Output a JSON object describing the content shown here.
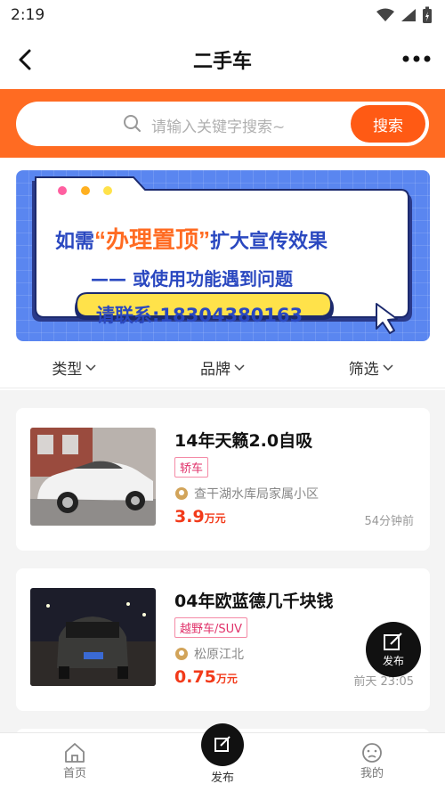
{
  "status": {
    "time": "2:19"
  },
  "header": {
    "title": "二手车"
  },
  "search": {
    "placeholder": "请输入关键字搜索~",
    "button": "搜索"
  },
  "banner": {
    "line1_pre": "如需",
    "line1_quote": "“办理置顶”",
    "line1_post": "扩大宣传效果",
    "line2": "—— 或使用功能遇到问题",
    "contact": "请联系:18304380163"
  },
  "filters": [
    "类型",
    "品牌",
    "筛选"
  ],
  "listings": [
    {
      "title": "14年天籁2.0自吸",
      "tag": "轿车",
      "location": "查干湖水库局家属小区",
      "price": "3.9",
      "unit": "万元",
      "time": "54分钟前"
    },
    {
      "title": "04年欧蓝德几千块钱",
      "tag": "越野车/SUV",
      "location": "松原江北",
      "price": "0.75",
      "unit": "万元",
      "time": "前天 23:05"
    }
  ],
  "fab": {
    "label": "发布"
  },
  "tabbar": {
    "home": "首页",
    "publish": "发布",
    "mine": "我的"
  },
  "colors": {
    "accent": "#ff6b22",
    "price": "#f23a1a",
    "banner": "#5a86f0"
  }
}
